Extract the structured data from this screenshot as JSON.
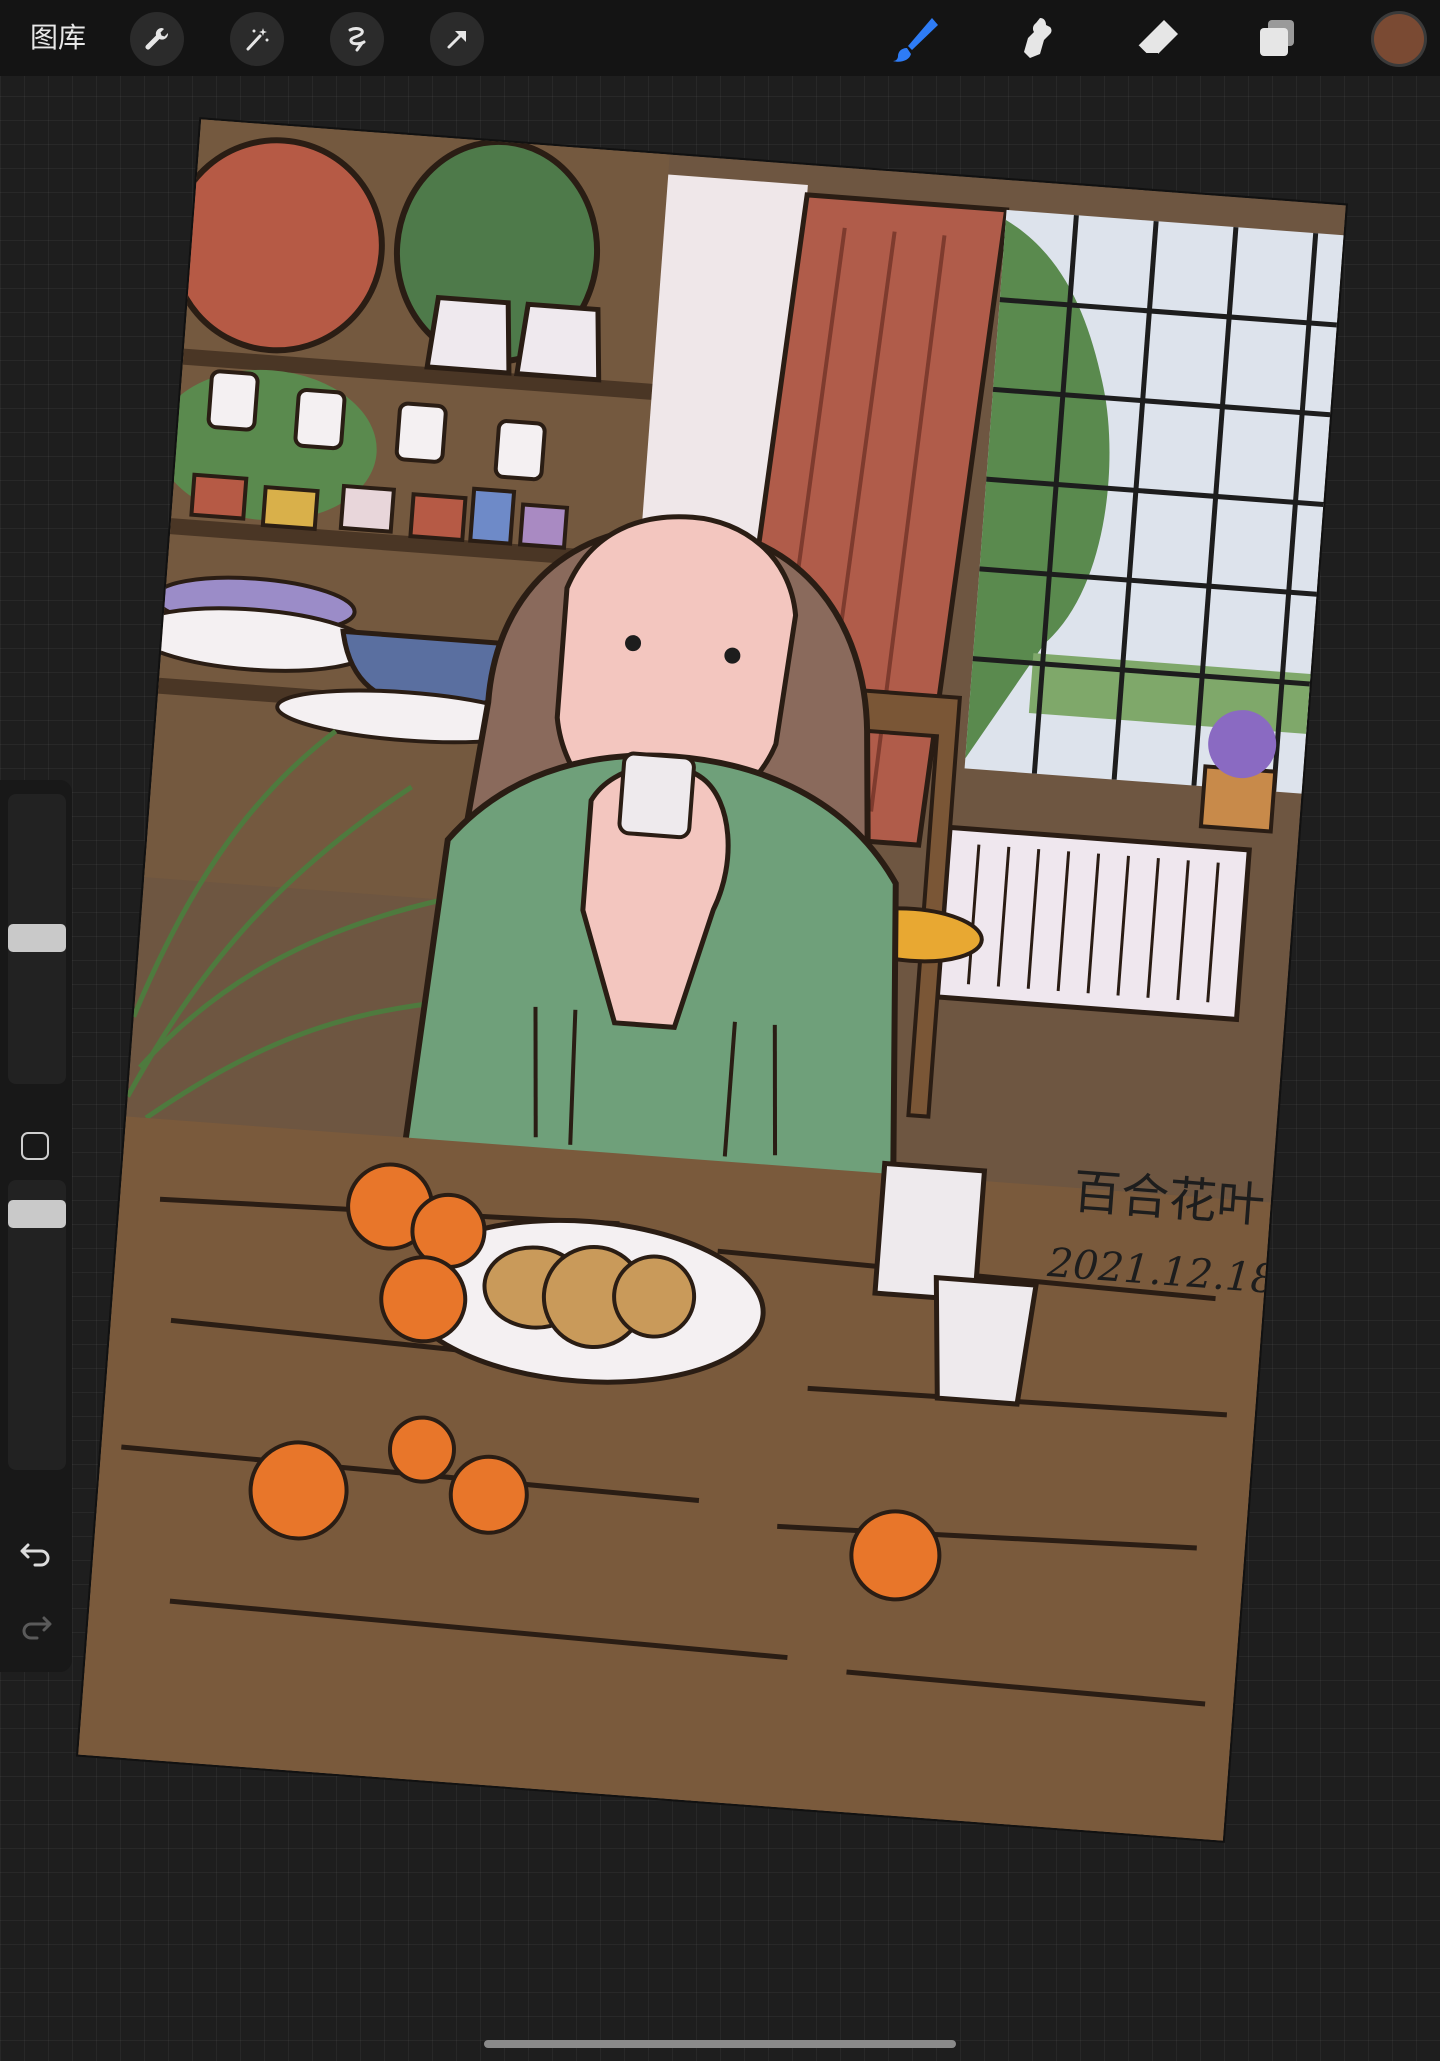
{
  "toolbar": {
    "gallery_label": "图库",
    "left_tools": [
      {
        "name": "wrench-icon"
      },
      {
        "name": "magic-wand-icon"
      },
      {
        "name": "selection-icon"
      },
      {
        "name": "transform-arrow-icon"
      }
    ],
    "right_tools": [
      {
        "name": "brush-icon",
        "active": true,
        "color": "#2e7cf6"
      },
      {
        "name": "smudge-icon"
      },
      {
        "name": "eraser-icon"
      },
      {
        "name": "layers-icon"
      }
    ],
    "current_color": "#7a4a33"
  },
  "sidebar": {
    "brush_size_level": 0.55,
    "opacity_level": 0.15,
    "undo_icon": "undo-icon",
    "redo_icon": "redo-icon"
  },
  "artwork": {
    "signature_name": "百合花叶",
    "signature_date": "2021.12.18",
    "palette": {
      "wall": "#6e5641",
      "curtain": "#b05c4a",
      "sweater": "#6fa07a",
      "hair": "#8a6a5c",
      "skin": "#f3c6bf",
      "table": "#7a5a3c",
      "orange": "#e8762a"
    }
  }
}
